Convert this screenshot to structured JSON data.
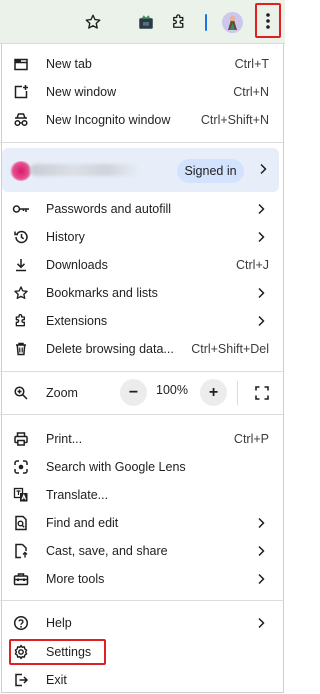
{
  "toolbar": {
    "icons": [
      "star-icon",
      "extension-app-icon",
      "puzzle-icon",
      "profile-avatar",
      "more-vert-icon"
    ]
  },
  "menu": {
    "group1": [
      {
        "label": "New tab",
        "shortcut": "Ctrl+T",
        "icon": "new-tab-icon"
      },
      {
        "label": "New window",
        "shortcut": "Ctrl+N",
        "icon": "new-window-icon"
      },
      {
        "label": "New Incognito window",
        "shortcut": "Ctrl+Shift+N",
        "icon": "incognito-icon"
      }
    ],
    "profile": {
      "status": "Signed in"
    },
    "group2": [
      {
        "label": "Passwords and autofill",
        "icon": "key-icon",
        "submenu": true
      },
      {
        "label": "History",
        "icon": "history-icon",
        "submenu": true
      },
      {
        "label": "Downloads",
        "shortcut": "Ctrl+J",
        "icon": "download-icon"
      },
      {
        "label": "Bookmarks and lists",
        "icon": "star-icon",
        "submenu": true
      },
      {
        "label": "Extensions",
        "icon": "puzzle-icon",
        "submenu": true
      },
      {
        "label": "Delete browsing data...",
        "shortcut": "Ctrl+Shift+Del",
        "icon": "trash-icon"
      }
    ],
    "zoom": {
      "label": "Zoom",
      "value": "100%",
      "minus": "−",
      "plus": "+"
    },
    "group3": [
      {
        "label": "Print...",
        "shortcut": "Ctrl+P",
        "icon": "print-icon"
      },
      {
        "label": "Search with Google Lens",
        "icon": "lens-icon"
      },
      {
        "label": "Translate...",
        "icon": "translate-icon"
      },
      {
        "label": "Find and edit",
        "icon": "find-icon",
        "submenu": true
      },
      {
        "label": "Cast, save, and share",
        "icon": "cast-icon",
        "submenu": true
      },
      {
        "label": "More tools",
        "icon": "toolbox-icon",
        "submenu": true
      }
    ],
    "group4": [
      {
        "label": "Help",
        "icon": "help-icon",
        "submenu": true
      },
      {
        "label": "Settings",
        "icon": "gear-icon"
      },
      {
        "label": "Exit",
        "icon": "exit-icon"
      }
    ]
  },
  "colors": {
    "highlight": "#e02020",
    "profile_bg": "#e8eef9",
    "pill_bg": "#d3e3fd",
    "accent": "#1a73e8"
  }
}
